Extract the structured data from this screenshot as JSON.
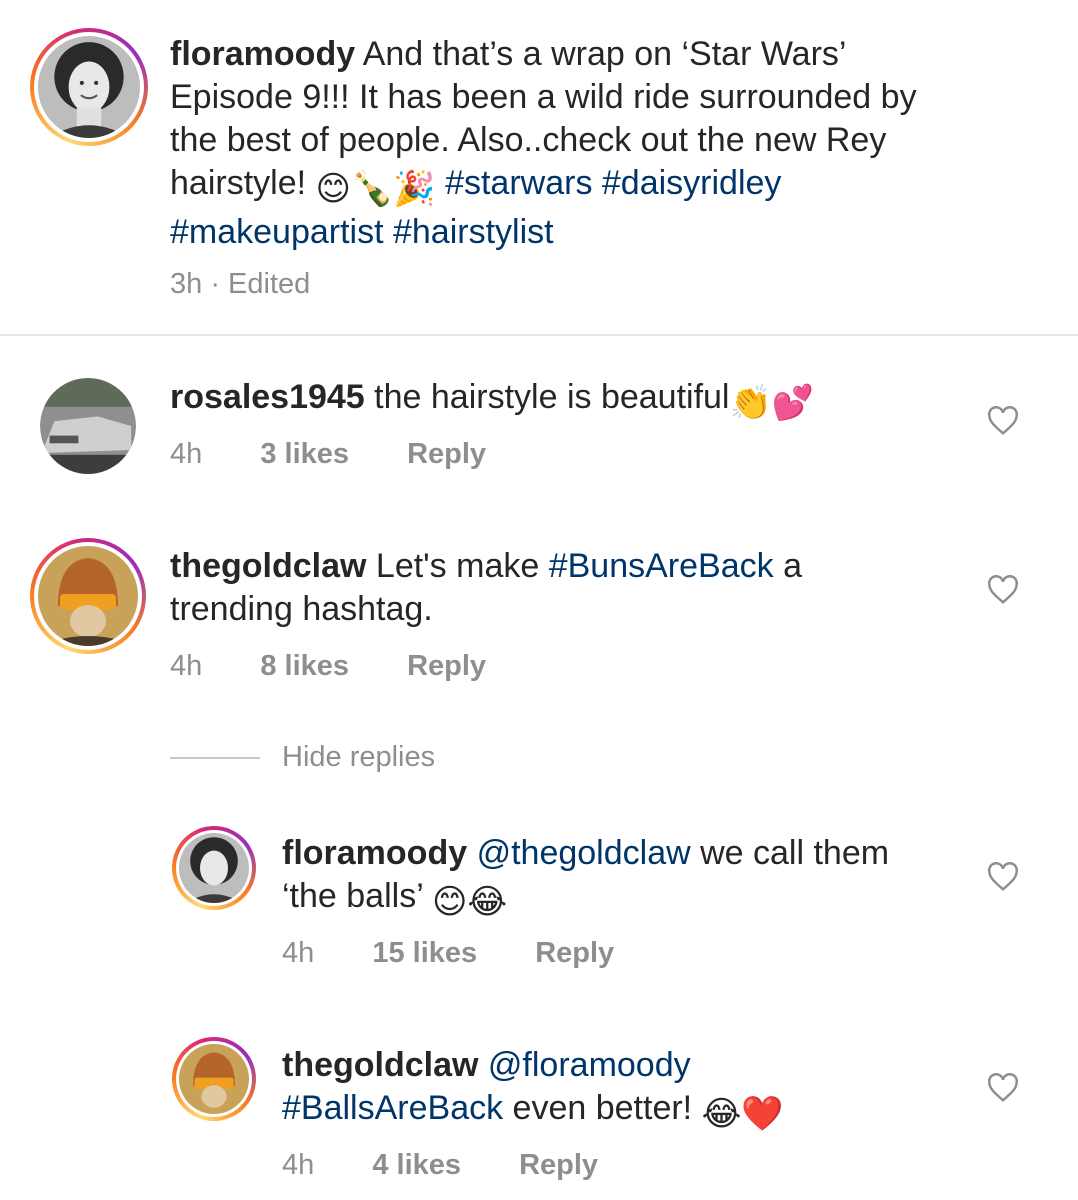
{
  "caption": {
    "username": "floramoody",
    "text_a": " And that’s a wrap on ‘Star Wars’ Episode 9!!! It has been a wild ride surrounded by the best of people. Also..check out the new Rey hairstyle! ",
    "emoji": "😊🍾🎉",
    "hashtags": "#starwars #daisyridley #makeupartist #hairstylist",
    "time": "3h",
    "edited": "Edited"
  },
  "comments": [
    {
      "username": "rosales1945",
      "text": " the hairstyle is beautiful",
      "emoji": "👏💕",
      "time": "4h",
      "likes": "3 likes",
      "reply": "Reply"
    },
    {
      "username": "thegoldclaw",
      "text_a": " Let's make ",
      "tag": "#BunsAreBack",
      "text_b": " a trending hashtag.",
      "time": "4h",
      "likes": "8 likes",
      "reply": "Reply"
    }
  ],
  "hide_replies": "Hide replies",
  "replies": [
    {
      "username": "floramoody",
      "mention": "@thegoldclaw",
      "text": " we call them ‘the balls’ ",
      "emoji": "😊😂",
      "time": "4h",
      "likes": "15 likes",
      "reply": "Reply"
    },
    {
      "username": "thegoldclaw",
      "mention": "@floramoody",
      "tag": "#BallsAreBack",
      "text": " even better! ",
      "emoji": "😂❤️",
      "time": "4h",
      "likes": "4 likes",
      "reply": "Reply"
    }
  ],
  "colors": {
    "link": "#003569",
    "meta": "#8e8e8e",
    "text": "#262626"
  }
}
